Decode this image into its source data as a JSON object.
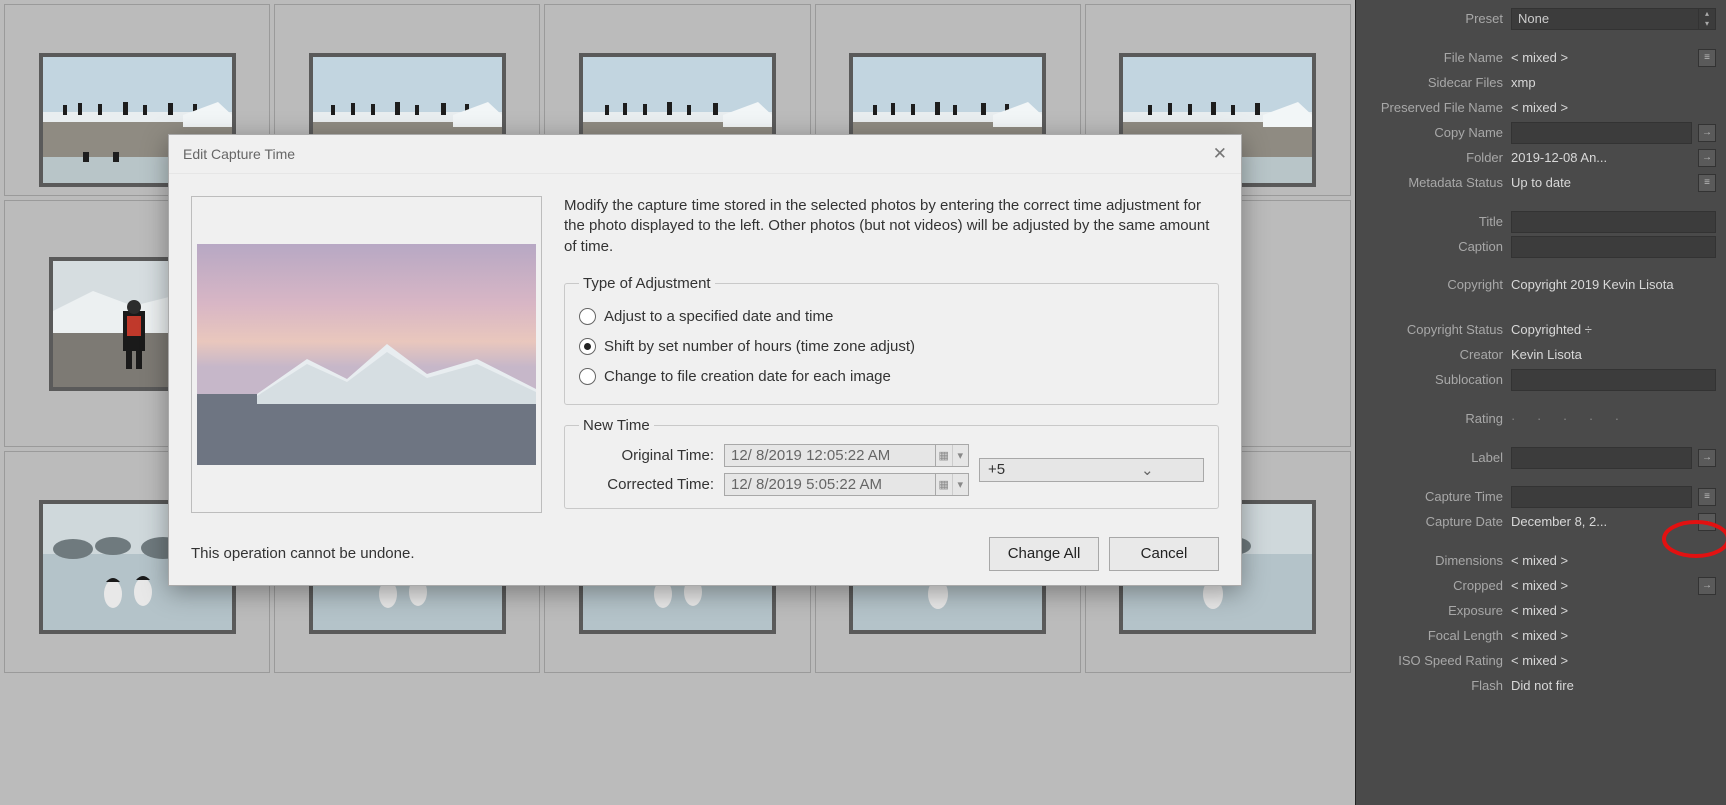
{
  "dialog": {
    "title": "Edit Capture Time",
    "description": "Modify the capture time stored in the selected photos by entering the correct time adjustment for the photo displayed to the left. Other photos (but not videos) will be adjusted by the same amount of time.",
    "adjustment_legend": "Type of Adjustment",
    "radios": {
      "specified": "Adjust to a specified date and time",
      "shift": "Shift by set number of hours (time zone adjust)",
      "filedate": "Change to file creation date for each image"
    },
    "newtime_legend": "New Time",
    "original_label": "Original Time:",
    "corrected_label": "Corrected Time:",
    "original_value": "12/  8/2019  12:05:22 AM",
    "corrected_value": "12/  8/2019    5:05:22 AM",
    "offset_value": "+5",
    "warning": "This operation cannot be undone.",
    "change_all": "Change All",
    "cancel": "Cancel"
  },
  "metadata": {
    "preset_label": "Preset",
    "preset_value": "None",
    "filename_label": "File Name",
    "filename_value": "< mixed >",
    "sidecar_label": "Sidecar Files",
    "sidecar_value": "xmp",
    "preserved_label": "Preserved File Name",
    "preserved_value": "< mixed >",
    "copyname_label": "Copy Name",
    "copyname_value": "",
    "folder_label": "Folder",
    "folder_value": "2019-12-08 An...",
    "mstatus_label": "Metadata Status",
    "mstatus_value": "Up to date",
    "title_label": "Title",
    "title_value": "",
    "caption_label": "Caption",
    "caption_value": "",
    "copyright_label": "Copyright",
    "copyright_value": "Copyright 2019 Kevin Lisota",
    "cstatus_label": "Copyright Status",
    "cstatus_value": "Copyrighted  ÷",
    "creator_label": "Creator",
    "creator_value": "Kevin Lisota",
    "sublocation_label": "Sublocation",
    "sublocation_value": "",
    "rating_label": "Rating",
    "rating_value": "·   ·   ·   ·   ·",
    "colorlabel_label": "Label",
    "colorlabel_value": "",
    "capturetime_label": "Capture Time",
    "capturetime_value": "",
    "capturedate_label": "Capture Date",
    "capturedate_value": "December 8, 2...",
    "dimensions_label": "Dimensions",
    "dimensions_value": "< mixed >",
    "cropped_label": "Cropped",
    "cropped_value": "< mixed >",
    "exposure_label": "Exposure",
    "exposure_value": "< mixed >",
    "focal_label": "Focal Length",
    "focal_value": "< mixed >",
    "iso_label": "ISO Speed Rating",
    "iso_value": "< mixed >",
    "flash_label": "Flash",
    "flash_value": "Did not fire"
  }
}
